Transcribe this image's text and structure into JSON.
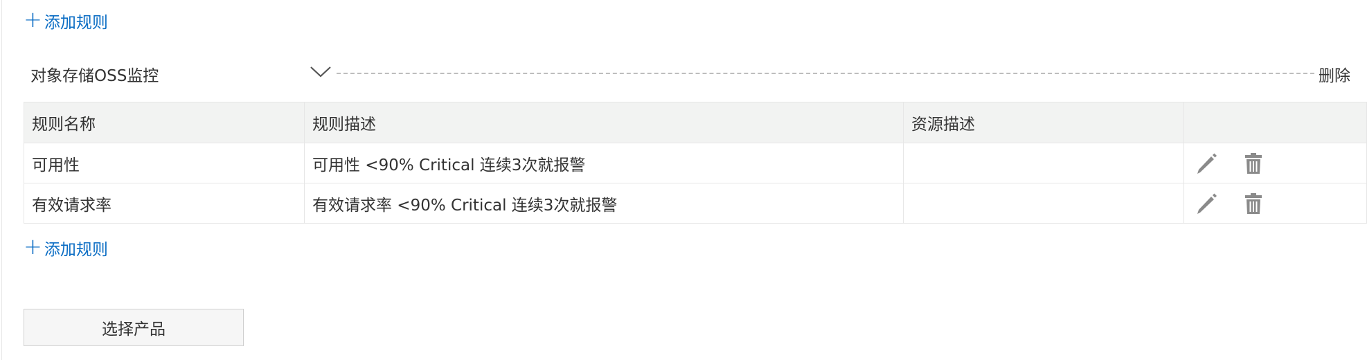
{
  "add_rule_top": {
    "plus": "+",
    "label": "添加规则"
  },
  "product_group": {
    "title": "对象存储OSS监控",
    "icon": "chevron-down-icon",
    "delete_label": "删除"
  },
  "rules_table": {
    "headers": [
      "规则名称",
      "规则描述",
      "资源描述",
      ""
    ],
    "rows": [
      {
        "name": "可用性",
        "description": "可用性 <90% Critical 连续3次就报警",
        "resource": ""
      },
      {
        "name": "有效请求率",
        "description": "有效请求率 <90% Critical 连续3次就报警",
        "resource": ""
      }
    ],
    "row_actions": [
      "edit-icon",
      "trash-icon"
    ]
  },
  "add_rule_bottom": {
    "plus": "+",
    "label": "添加规则"
  },
  "select_product_button": {
    "label": "选择产品"
  },
  "colors": {
    "link": "#0b6dc4",
    "header_bg": "#f2f3f2",
    "border": "#e6e6e6",
    "icon": "#8a8a8a"
  }
}
